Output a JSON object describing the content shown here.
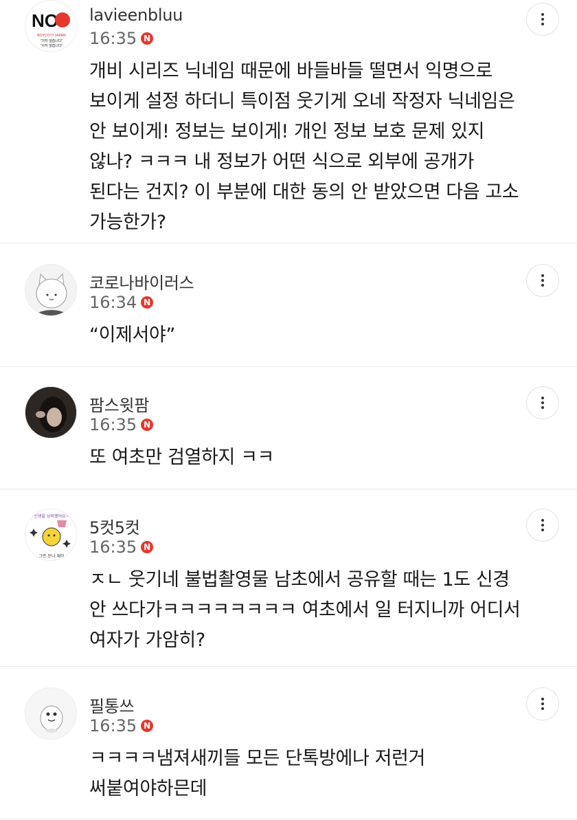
{
  "comments": [
    {
      "author": "lavieenbluu",
      "time": "16:35",
      "badge": "N",
      "avatar_text": "NO",
      "avatar_small_1": "BOYCOTT JAPAN",
      "avatar_small_2": "\"가지 않습니다\"",
      "avatar_small_3": "\"사지 않습니다\"",
      "lines": [
        "개비 시리즈 닉네임 때문에 바들바들 떨면서 익명으로",
        "보이게 설정 하더니 특이점 웃기게 오네 작정자 닉네임은",
        "안 보이게! 정보는 보이게! 개인 정보 보호 문제 있지",
        "않나? ㅋㅋㅋ 내 정보가 어떤 식으로 외부에 공개가",
        "된다는 건지? 이 부분에 대한 동의 안 받았으면 다음 고소",
        "가능한가?"
      ]
    },
    {
      "author": "코로나바이러스",
      "time": "16:34",
      "badge": "N",
      "lines": [
        "“이제서야”"
      ]
    },
    {
      "author": "팜스윗팜",
      "time": "16:35",
      "badge": "N",
      "lines": [
        "또 여초만 검열하지 ㅋㅋ"
      ]
    },
    {
      "author": "5컷5컷",
      "time": "16:35",
      "badge": "N",
      "avatar_text_top": "신생을 낭비했어요~",
      "avatar_text_bottom": "그런 둔나 재미",
      "lines": [
        "ㅈㄴ 웃기네 불법촬영물 남초에서 공유할 때는 1도 신경",
        "안 쓰다가ㅋㅋㅋㅋㅋㅋㅋㅋ 여초에서 일 터지니까 어디서",
        "여자가 가암히?"
      ]
    },
    {
      "author": "필통쓰",
      "time": "16:35",
      "badge": "N",
      "lines": [
        "ㅋㅋㅋㅋ냄져새끼들 모든 단톡방에나 저런거",
        "써붙여야하믄데"
      ]
    }
  ],
  "colors": {
    "badge": "#e5392f",
    "divider": "#e8e8e8",
    "text": "#1a1a1a",
    "meta": "#666666"
  }
}
